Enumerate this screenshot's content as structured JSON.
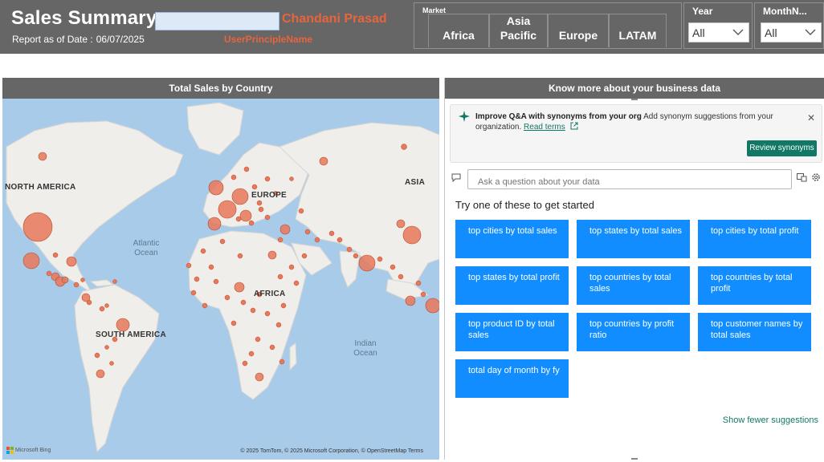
{
  "header": {
    "title": "Sales Summary",
    "report_date_label": "Report as of Date :",
    "report_date": "06/07/2025",
    "user_name": "Chandani Prasad",
    "user_principle_label": "UserPrincipleName"
  },
  "market": {
    "label": "Market",
    "options": [
      {
        "label": "Africa"
      },
      {
        "label": "Asia Pacific"
      },
      {
        "label": "Europe"
      },
      {
        "label": "LATAM"
      }
    ]
  },
  "slicers": {
    "year": {
      "label": "Year",
      "value": "All"
    },
    "month": {
      "label": "MonthN...",
      "value": "All"
    }
  },
  "map": {
    "title": "Total Sales by Country",
    "continent_labels": [
      "NORTH AMERICA",
      "EUROPE",
      "ASIA",
      "AFRICA",
      "SOUTH AMERICA"
    ],
    "ocean_labels": [
      "Atlantic Ocean",
      "Indian Ocean"
    ],
    "bing_label": "Microsoft Bing",
    "attribution": "© 2025 TomTom, © 2025 Microsoft Corporation, © OpenStreetMap   Terms",
    "colors": {
      "ocean": "#a9cbea",
      "land": "#efeeea",
      "bubble": "#e8785a",
      "bubble_stroke": "#b84a2a"
    }
  },
  "qa": {
    "title": "Know more about your business data",
    "tip_bold": "Improve Q&A with synonyms from your org",
    "tip_text": "Add synonym suggestions from your organization.",
    "read_terms": "Read terms",
    "review_button": "Review synonyms",
    "ask_placeholder": "Ask a question about your data",
    "try_text": "Try one of these to get started",
    "suggestions": [
      "top cities by total sales",
      "top states by total sales",
      "top cities by total profit",
      "top states by total profit",
      "top countries by total sales",
      "top countries by total profit",
      "top product ID by total sales",
      "top countries by profit ratio",
      "top customer names by total sales",
      "total day of month by fy"
    ],
    "show_fewer": "Show fewer suggestions",
    "colors": {
      "suggestion": "#118dff",
      "accent": "#117865"
    }
  }
}
